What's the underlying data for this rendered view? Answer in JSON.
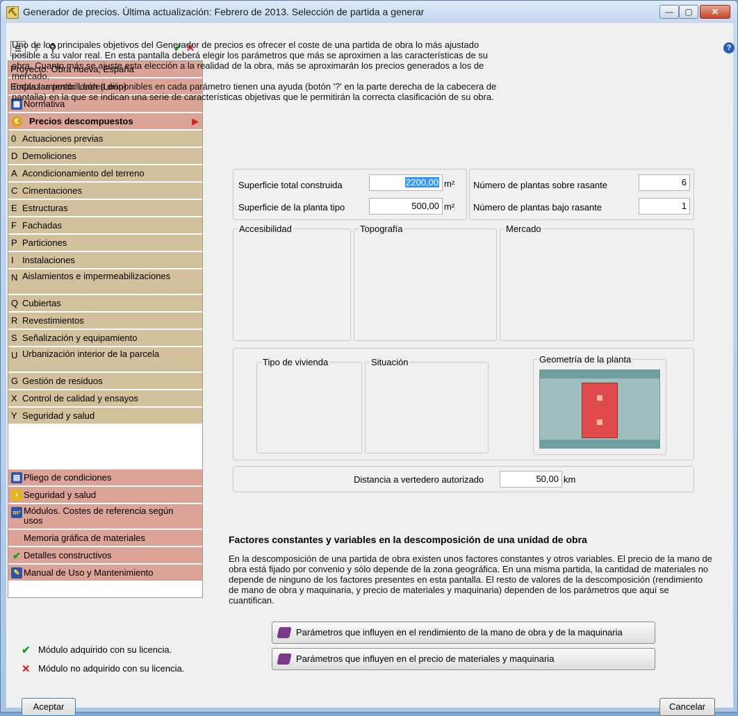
{
  "window": {
    "title": "Generador de precios. Última actualización: Febrero de 2013. Selección de partida a generar",
    "minimize_glyph": "—",
    "maximize_glyph": "▢",
    "close_glyph": "✕"
  },
  "toolbar": {
    "check_glyph": "✔",
    "cross_glyph": "✕"
  },
  "tree": {
    "proyecto": "Proyecto: Obra nueva, España",
    "emplazamiento": "Emplazamiento: León (León)",
    "normativa": "Normativa",
    "precios": "Precios descompuestos",
    "chapters": [
      {
        "code": "0",
        "label": "Actuaciones previas"
      },
      {
        "code": "D",
        "label": "Demoliciones"
      },
      {
        "code": "A",
        "label": "Acondicionamiento del terreno"
      },
      {
        "code": "C",
        "label": "Cimentaciones"
      },
      {
        "code": "E",
        "label": "Estructuras"
      },
      {
        "code": "F",
        "label": "Fachadas"
      },
      {
        "code": "P",
        "label": "Particiones"
      },
      {
        "code": "I",
        "label": "Instalaciones"
      },
      {
        "code": "N",
        "label": "Aislamientos e impermeabilizaciones"
      },
      {
        "code": "Q",
        "label": "Cubiertas"
      },
      {
        "code": "R",
        "label": "Revestimientos"
      },
      {
        "code": "S",
        "label": "Señalización y equipamiento"
      },
      {
        "code": "U",
        "label": "Urbanización interior de la parcela"
      },
      {
        "code": "G",
        "label": "Gestión de residuos"
      },
      {
        "code": "X",
        "label": "Control de calidad y ensayos"
      },
      {
        "code": "Y",
        "label": "Seguridad y salud"
      }
    ],
    "pliego": "Pliego de condiciones",
    "seguridad": "Seguridad y salud",
    "modulos": "Módulos. Costes de referencia según usos",
    "memoria": "Memoria gráfica de materiales",
    "detalles": "Detalles constructivos",
    "manual": "Manual de Uso y Mantenimiento"
  },
  "legend": {
    "acquired": "Módulo adquirido con su licencia.",
    "not_acquired": "Módulo no adquirido con su licencia."
  },
  "intro": {
    "line1": "Uno de los principales objetivos del Generador de precios es ofrecer el coste de una partida de obra lo más ajustado posible a su valor real. En esta pantalla deberá elegir los parámetros que más se aproximen a las características de su obra. Cuanto más se ajuste esta elección a la realidad de la obra, más se aproximarán los precios generados a los de mercado.",
    "line2": "Todas las posibilidades disponibles en cada parámetro tienen una ayuda (botón '?' en la parte derecha de la cabecera de pantalla) en la que se indican una serie de características objetivas que le permitirán la correcta clasificación de su obra."
  },
  "form": {
    "sup_total_label": "Superficie total construida",
    "sup_total_value": "2200,00",
    "sup_total_unit": "m²",
    "sup_tipo_label": "Superficie de la planta tipo",
    "sup_tipo_value": "500,00",
    "sup_tipo_unit": "m²",
    "plantas_sobre_label": "Número de plantas sobre rasante",
    "plantas_sobre_value": "6",
    "plantas_bajo_label": "Número de plantas bajo rasante",
    "plantas_bajo_value": "1",
    "accesibilidad": "Accesibilidad",
    "topografia": "Topografía",
    "mercado": "Mercado",
    "tipo_vivienda": "Tipo de vivienda",
    "situacion": "Situación",
    "geometria": "Geometría de la planta",
    "distancia_label": "Distancia a vertedero autorizado",
    "distancia_value": "50,00",
    "distancia_unit": "km"
  },
  "factores": {
    "heading": "Factores constantes y variables en la descomposición de una unidad de obra",
    "text": "En la descomposición de una partida de obra existen unos factores constantes y otros variables. El precio de la mano de obra está fijado por convenio y sólo depende de la zona geográfica. En una misma partida, la cantidad de materiales no depende de ninguno de los factores presentes en esta pantalla. El resto de valores de la descomposición (rendimiento de mano de obra y maquinaria, y precio de materiales y maquinaria) dependen de los parámetros que aquí se cuantifican.",
    "btn_rendimiento": "Parámetros que influyen en el rendimiento de la mano de obra y de la maquinaria",
    "btn_precio": "Parámetros que influyen en el precio de materiales y maquinaria"
  },
  "footer": {
    "accept": "Aceptar",
    "cancel": "Cancelar"
  },
  "colors": {
    "pink_row": "#dba497",
    "tan_row": "#d3c19e",
    "geometry_red": "#e04a4a",
    "geometry_teal": "#9fbfbf"
  }
}
